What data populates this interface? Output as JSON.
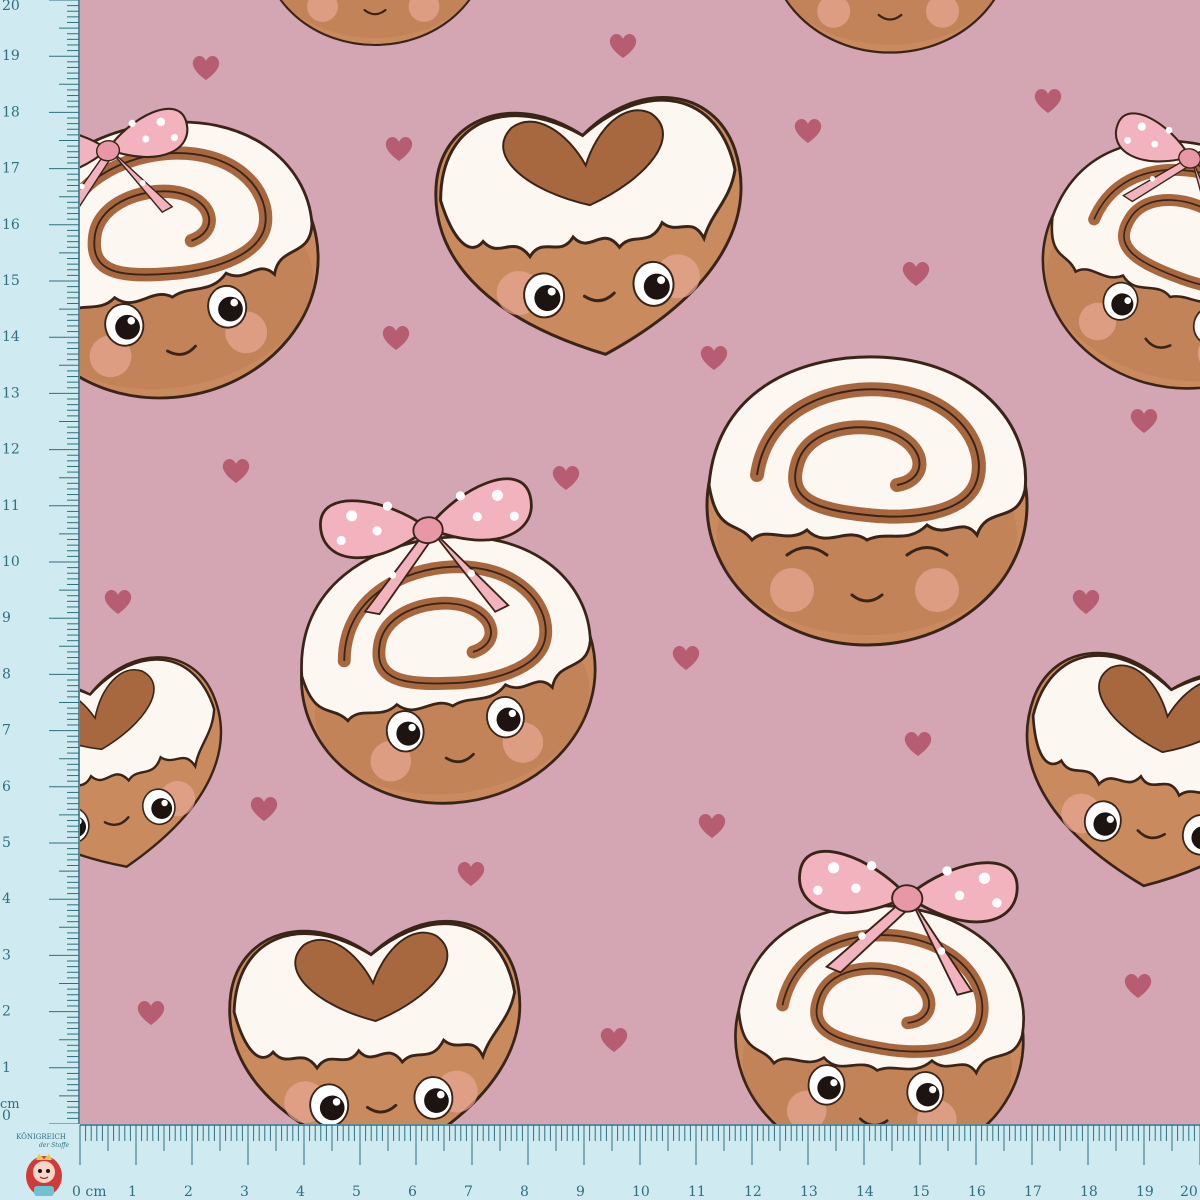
{
  "ruler": {
    "left_labels": [
      "20",
      "19",
      "18",
      "17",
      "16",
      "15",
      "14",
      "13",
      "12",
      "11",
      "10",
      "9",
      "8",
      "7",
      "6",
      "5",
      "4",
      "3",
      "2",
      "1",
      "0"
    ],
    "left_unit": "cm",
    "bottom_labels": [
      "0 cm",
      "1",
      "2",
      "3",
      "4",
      "5",
      "6",
      "7",
      "8",
      "9",
      "10",
      "11",
      "12",
      "13",
      "14",
      "15",
      "16",
      "17",
      "18",
      "19",
      "20"
    ]
  },
  "logo": {
    "line1": "KÖNIGREICH",
    "line2": "der Stoffe"
  },
  "colors": {
    "fabric_background": "#d4a5b2",
    "heart": "#b65d72",
    "dough": "#c98a5e",
    "icing": "#fdf7f2",
    "bow": "#f2b3be",
    "ruler": "#cfeaf0",
    "ruler_ink": "#2f6f80"
  },
  "pattern": {
    "motifs": [
      "cinnamon-roll-with-bow",
      "heart-shaped-cinnamon-roll",
      "cinnamon-roll",
      "small-heart"
    ]
  }
}
